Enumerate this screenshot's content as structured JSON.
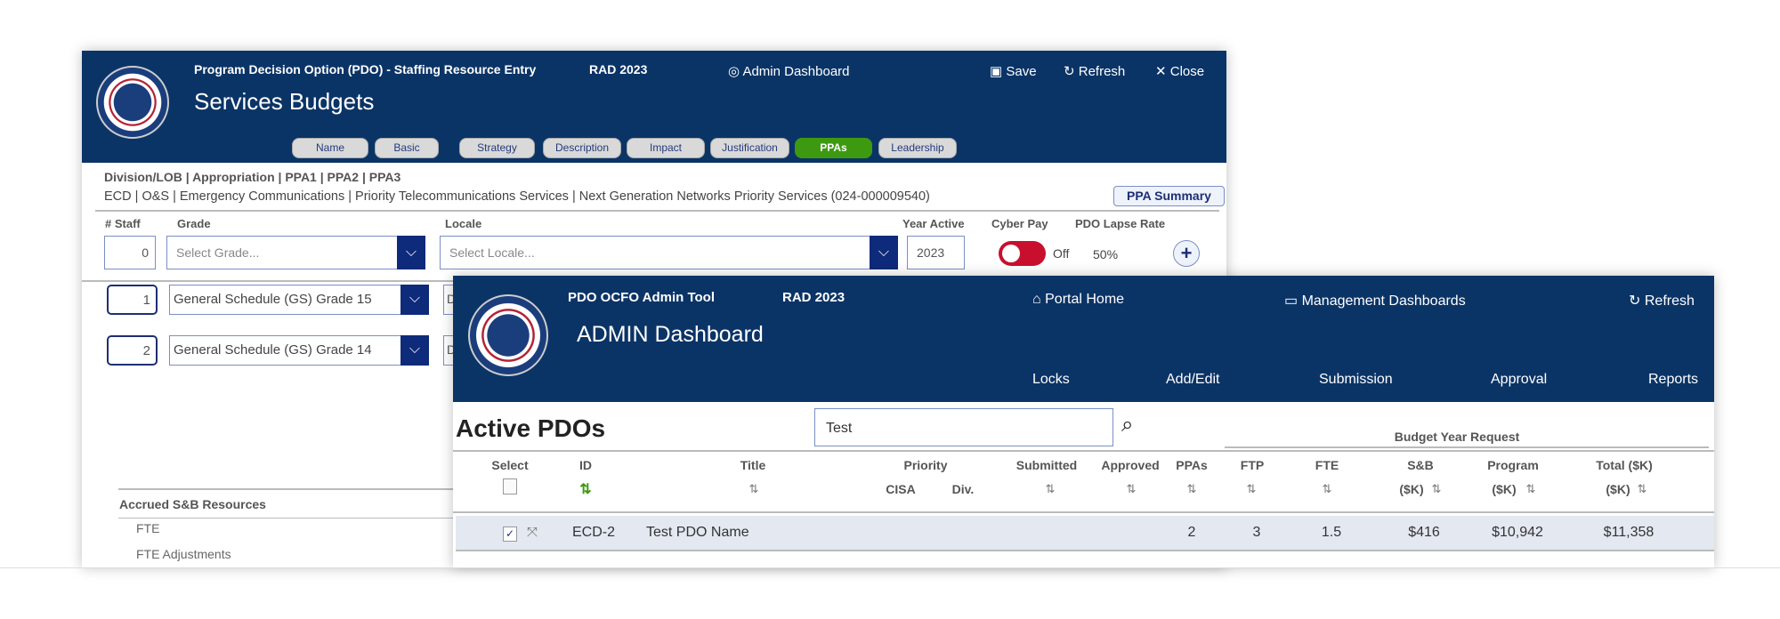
{
  "pdo_entry": {
    "app_title": "Program Decision Option (PDO) - Staffing Resource Entry",
    "rad": "RAD 2023",
    "admin_dashboard_link": "Admin Dashboard",
    "save": "Save",
    "refresh": "Refresh",
    "close": "Close",
    "page_title": "Services Budgets",
    "tabs": [
      {
        "label": "Name"
      },
      {
        "label": "Basic"
      },
      {
        "label": "Strategy"
      },
      {
        "label": "Description"
      },
      {
        "label": "Impact"
      },
      {
        "label": "Justification"
      },
      {
        "label": "PPAs",
        "active": true
      },
      {
        "label": "Leadership"
      }
    ],
    "hierarchy_label": "Division/LOB | Appropriation | PPA1 | PPA2 | PPA3",
    "hierarchy_value": "ECD | O&S | Emergency Communications | Priority Telecommunications Services | Next Generation Networks Priority Services (024-000009540)",
    "ppa_summary": "PPA Summary",
    "columns": {
      "staff": "# Staff",
      "grade": "Grade",
      "locale": "Locale",
      "year": "Year Active",
      "cyber": "Cyber Pay",
      "lapse": "PDO Lapse Rate"
    },
    "new_entry": {
      "staff": "0",
      "grade_placeholder": "Select Grade...",
      "locale_placeholder": "Select Locale...",
      "year": "2023",
      "cyber_pay": "Off",
      "cyber_pay_on": false,
      "lapse_rate": "50%"
    },
    "rows": [
      {
        "staff": "1",
        "grade": "General Schedule (GS) Grade 15",
        "locale": "D"
      },
      {
        "staff": "2",
        "grade": "General Schedule (GS) Grade 14",
        "locale": "D"
      }
    ],
    "accrued_title": "Accrued S&B Resources",
    "accrued_items": [
      "FTE",
      "FTE Adjustments"
    ]
  },
  "admin": {
    "app_title": "PDO OCFO Admin Tool",
    "rad": "RAD 2023",
    "portal_home": "Portal Home",
    "mgmt_dashboards": "Management Dashboards",
    "refresh": "Refresh",
    "page_title": "ADMIN Dashboard",
    "nav": [
      "Locks",
      "Add/Edit",
      "Submission",
      "Approval",
      "Reports"
    ],
    "section_title": "Active PDOs",
    "search_value": "Test",
    "budget_year_request": "Budget Year Request",
    "headers": {
      "select": "Select",
      "id": "ID",
      "title": "Title",
      "priority": "Priority",
      "cisa": "CISA",
      "div": "Div.",
      "submitted": "Submitted",
      "approved": "Approved",
      "ppas": "PPAs",
      "ftp": "FTP",
      "fte": "FTE",
      "sb": "S&B",
      "program": "Program",
      "total": "Total ($K)",
      "sb_unit": "($K)",
      "program_unit": "($K)",
      "total_unit": "($K)"
    },
    "rows": [
      {
        "selected": true,
        "id": "ECD-2",
        "title": "Test PDO Name",
        "ppas": "2",
        "ftp": "3",
        "fte": "1.5",
        "sb": "$416",
        "program": "$10,942",
        "total": "$11,358"
      }
    ]
  },
  "colors": {
    "header": "#0b3466",
    "active_tab": "#3d9a10",
    "toggle_off": "#c8102e",
    "dropdown": "#0e2a7a"
  }
}
